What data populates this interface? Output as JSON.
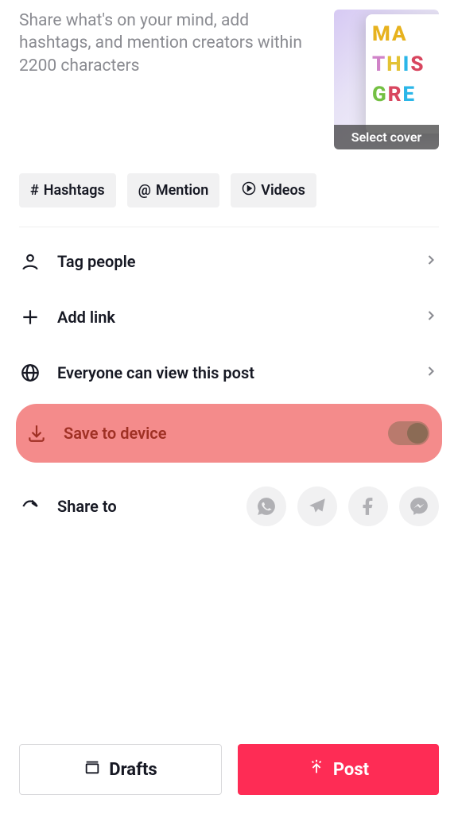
{
  "caption": {
    "placeholder": "Share what's on your mind, add hashtags, and mention creators within 2200 characters"
  },
  "cover": {
    "label": "Select cover"
  },
  "chips": {
    "hashtags": "Hashtags",
    "mention": "Mention",
    "videos": "Videos"
  },
  "options": {
    "tag_people": "Tag people",
    "add_link": "Add link",
    "privacy": "Everyone can view this post",
    "save_device": "Save to device",
    "share_to": "Share to"
  },
  "save_to_device": {
    "enabled": true,
    "highlighted": true
  },
  "buttons": {
    "drafts": "Drafts",
    "post": "Post"
  },
  "colors": {
    "primary": "#fe2c55",
    "highlight_bg": "#f48b8b",
    "highlight_text": "#9f3024",
    "muted": "#8a8b91",
    "chip_bg": "#f1f1f2"
  }
}
